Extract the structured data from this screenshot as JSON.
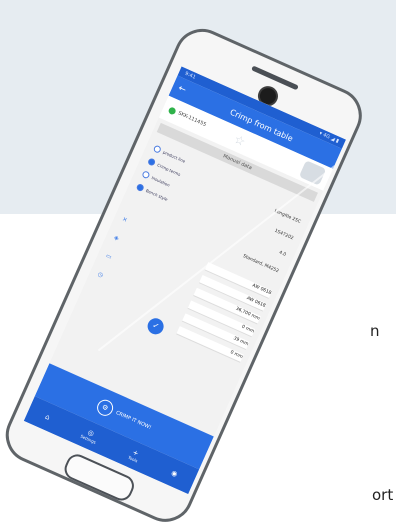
{
  "side_text": {
    "left_n": "n",
    "bottom_port": "ort"
  },
  "status_bar": {
    "left": "9:41",
    "right": "▾ 4G ◢ ▮"
  },
  "app_bar": {
    "back_icon": "←",
    "title": "Crimp from table"
  },
  "connection": {
    "device": "SKK-111455"
  },
  "manual_label": "Manual data",
  "options": [
    {
      "label": "product line",
      "selected": false
    },
    {
      "label": "Crimp terms",
      "selected": true
    },
    {
      "label": "Insulation",
      "selected": false
    },
    {
      "label": "Bench style",
      "selected": true
    }
  ],
  "values": [
    {
      "value": "Longitle 2SC"
    },
    {
      "value": "1S47202"
    },
    {
      "value": "4.0"
    },
    {
      "value": "Standard, M4252"
    }
  ],
  "measurements": [
    {
      "value": "AW 0618"
    },
    {
      "value": "AW 0618"
    },
    {
      "value": "36,700",
      "unit": "mm"
    },
    {
      "value": "0",
      "unit": "mm"
    },
    {
      "value": "39",
      "unit": "mm"
    },
    {
      "value": "0",
      "unit": "mm"
    }
  ],
  "crimp_button": {
    "label": "CRIMP IT NOW!"
  },
  "bottom_nav": [
    {
      "icon": "home-icon",
      "glyph": "⌂",
      "label": ""
    },
    {
      "icon": "settings-icon",
      "glyph": "◎",
      "label": "Settings"
    },
    {
      "icon": "add-icon",
      "glyph": "+",
      "label": "Tools"
    },
    {
      "icon": "profile-icon",
      "glyph": "◉",
      "label": ""
    }
  ],
  "colors": {
    "primary": "#2b70e4",
    "dark_primary": "#1f5fd1",
    "background_band": "#e6ecf1"
  }
}
